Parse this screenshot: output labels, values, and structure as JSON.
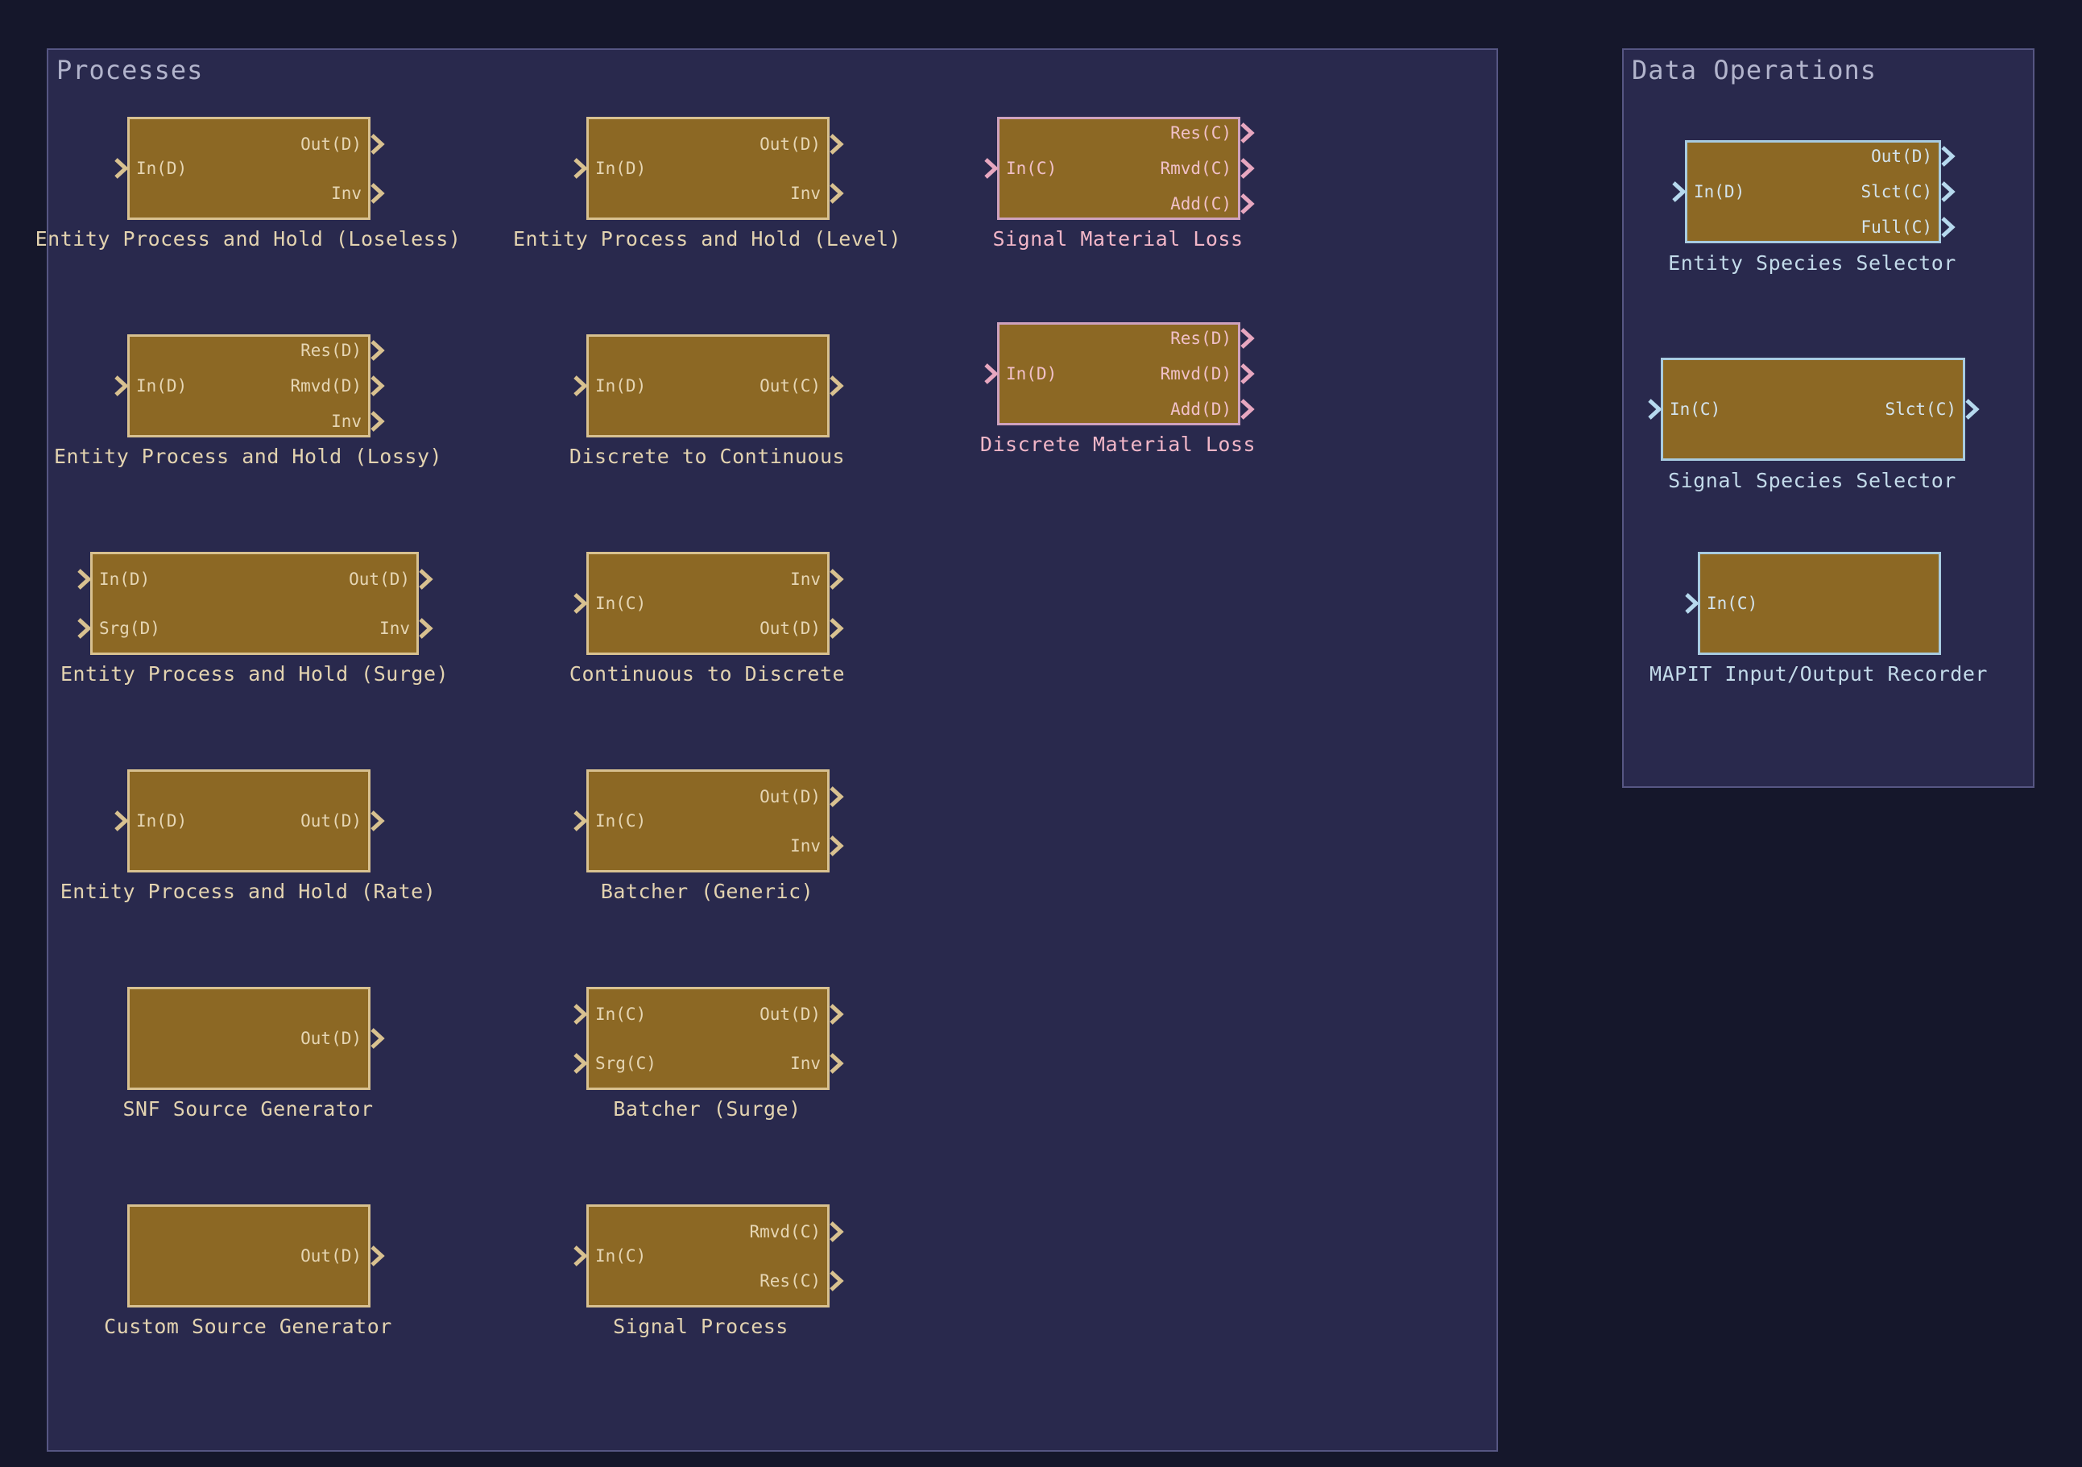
{
  "groups": [
    {
      "id": "processes",
      "title": "Processes"
    },
    {
      "id": "dataops",
      "title": "Data Operations"
    }
  ],
  "blocks": [
    {
      "id": "ephl-loseless",
      "group": "processes",
      "label": "Entity Process and Hold (Loseless)",
      "style": "gold",
      "inputs": [
        "In(D)"
      ],
      "outputs": [
        "Out(D)",
        "Inv"
      ]
    },
    {
      "id": "ephl-level",
      "group": "processes",
      "label": "Entity Process and Hold (Level)",
      "style": "gold",
      "inputs": [
        "In(D)"
      ],
      "outputs": [
        "Out(D)",
        "Inv"
      ]
    },
    {
      "id": "signal-material-loss",
      "group": "processes",
      "label": "Signal Material Loss",
      "style": "pink",
      "inputs": [
        "In(C)"
      ],
      "outputs": [
        "Res(C)",
        "Rmvd(C)",
        "Add(C)"
      ]
    },
    {
      "id": "ephl-lossy",
      "group": "processes",
      "label": "Entity Process and Hold (Lossy)",
      "style": "gold",
      "inputs": [
        "In(D)"
      ],
      "outputs": [
        "Res(D)",
        "Rmvd(D)",
        "Inv"
      ]
    },
    {
      "id": "discrete-to-continuous",
      "group": "processes",
      "label": "Discrete to Continuous",
      "style": "gold",
      "inputs": [
        "In(D)"
      ],
      "outputs": [
        "Out(C)"
      ]
    },
    {
      "id": "discrete-material-loss",
      "group": "processes",
      "label": "Discrete Material Loss",
      "style": "pink",
      "inputs": [
        "In(D)"
      ],
      "outputs": [
        "Res(D)",
        "Rmvd(D)",
        "Add(D)"
      ]
    },
    {
      "id": "ephl-surge",
      "group": "processes",
      "label": "Entity Process and Hold (Surge)",
      "style": "gold",
      "inputs": [
        "In(D)",
        "Srg(D)"
      ],
      "outputs": [
        "Out(D)",
        "Inv"
      ]
    },
    {
      "id": "continuous-to-discrete",
      "group": "processes",
      "label": "Continuous to Discrete",
      "style": "gold",
      "inputs": [
        "In(C)"
      ],
      "outputs": [
        "Inv",
        "Out(D)"
      ]
    },
    {
      "id": "ephl-rate",
      "group": "processes",
      "label": "Entity Process and Hold (Rate)",
      "style": "gold",
      "inputs": [
        "In(D)"
      ],
      "outputs": [
        "Out(D)"
      ]
    },
    {
      "id": "batcher-generic",
      "group": "processes",
      "label": "Batcher (Generic)",
      "style": "gold",
      "inputs": [
        "In(C)"
      ],
      "outputs": [
        "Out(D)",
        "Inv"
      ]
    },
    {
      "id": "snf-source-generator",
      "group": "processes",
      "label": "SNF Source Generator",
      "style": "gold",
      "inputs": [],
      "outputs": [
        "Out(D)"
      ]
    },
    {
      "id": "batcher-surge",
      "group": "processes",
      "label": "Batcher (Surge)",
      "style": "gold",
      "inputs": [
        "In(C)",
        "Srg(C)"
      ],
      "outputs": [
        "Out(D)",
        "Inv"
      ]
    },
    {
      "id": "custom-source-generator",
      "group": "processes",
      "label": "Custom Source Generator",
      "style": "gold",
      "inputs": [],
      "outputs": [
        "Out(D)"
      ]
    },
    {
      "id": "signal-process",
      "group": "processes",
      "label": "Signal Process",
      "style": "gold",
      "inputs": [
        "In(C)"
      ],
      "outputs": [
        "Rmvd(C)",
        "Res(C)"
      ]
    },
    {
      "id": "entity-species-selector",
      "group": "dataops",
      "label": "Entity Species Selector",
      "style": "blue",
      "inputs": [
        "In(D)"
      ],
      "outputs": [
        "Out(D)",
        "Slct(C)",
        "Full(C)"
      ]
    },
    {
      "id": "signal-species-selector",
      "group": "dataops",
      "label": "Signal Species Selector",
      "style": "blue",
      "inputs": [
        "In(C)"
      ],
      "outputs": [
        "Slct(C)"
      ]
    },
    {
      "id": "mapit-io-recorder",
      "group": "dataops",
      "label": "MAPIT Input/Output Recorder",
      "style": "blue",
      "inputs": [
        "In(C)"
      ],
      "outputs": []
    }
  ],
  "colors": {
    "background": "#15172b",
    "panel": "#29294d",
    "block_fill": "#8c6824",
    "gold_border": "#d8c190",
    "pink_border": "#cfa2be",
    "blue_border": "#a8cbe0"
  }
}
